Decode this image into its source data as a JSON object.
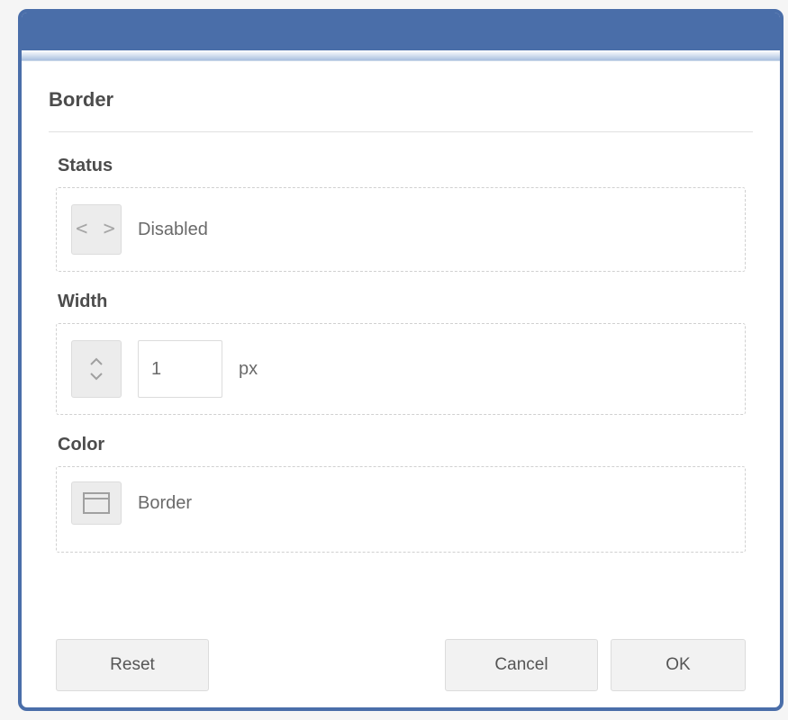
{
  "dialog": {
    "title": "Border"
  },
  "status": {
    "label": "Status",
    "value": "Disabled"
  },
  "width": {
    "label": "Width",
    "value": "1",
    "unit": "px"
  },
  "color": {
    "label": "Color",
    "value": "Border"
  },
  "buttons": {
    "reset": "Reset",
    "cancel": "Cancel",
    "ok": "OK"
  }
}
